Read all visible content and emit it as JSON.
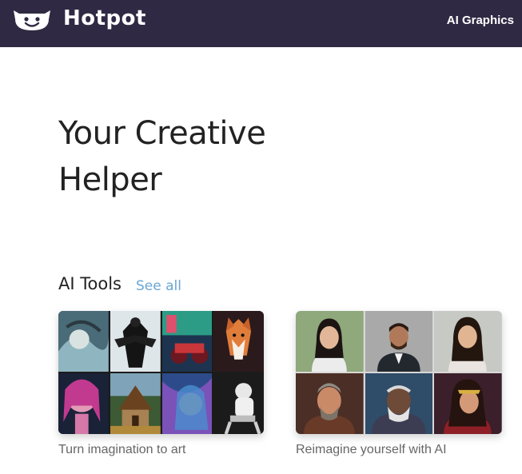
{
  "header": {
    "brand": "Hotpot",
    "nav_link": "AI Graphics",
    "logo_icon": "smiling-pot-icon",
    "background": "#2f2943"
  },
  "hero": {
    "title": "Your Creative Helper"
  },
  "tools": {
    "section_title": "AI Tools",
    "see_all": "See all",
    "link_color": "#6aa7d4",
    "cards": [
      {
        "caption": "Turn imagination to art"
      },
      {
        "caption": "Reimagine yourself with AI"
      }
    ]
  }
}
